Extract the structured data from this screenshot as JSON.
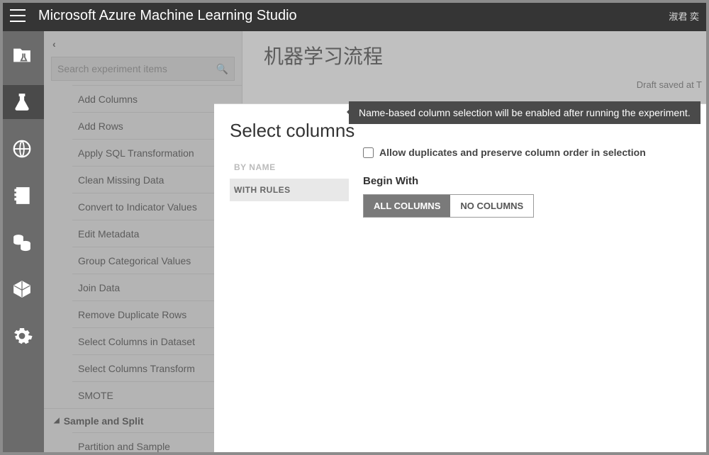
{
  "header": {
    "title": "Microsoft Azure Machine Learning Studio",
    "user": "淑君 奕"
  },
  "sidebar": {
    "search_placeholder": "Search experiment items",
    "items": [
      "Add Columns",
      "Add Rows",
      "Apply SQL Transformation",
      "Clean Missing Data",
      "Convert to Indicator Values",
      "Edit Metadata",
      "Group Categorical Values",
      "Join Data",
      "Remove Duplicate Rows",
      "Select Columns in Dataset",
      "Select Columns Transform",
      "SMOTE"
    ],
    "category": "Sample and Split",
    "extra": "Partition and Sample"
  },
  "canvas": {
    "title": "机器学习流程",
    "draft": "Draft saved at T"
  },
  "modal": {
    "title": "Select columns",
    "tabs": {
      "by_name": "BY NAME",
      "with_rules": "WITH RULES"
    },
    "tooltip": "Name-based column selection will be enabled after running the experiment.",
    "allow_dup": "Allow duplicates and preserve column order in selection",
    "begin_with": "Begin With",
    "all_columns": "ALL COLUMNS",
    "no_columns": "NO COLUMNS"
  }
}
